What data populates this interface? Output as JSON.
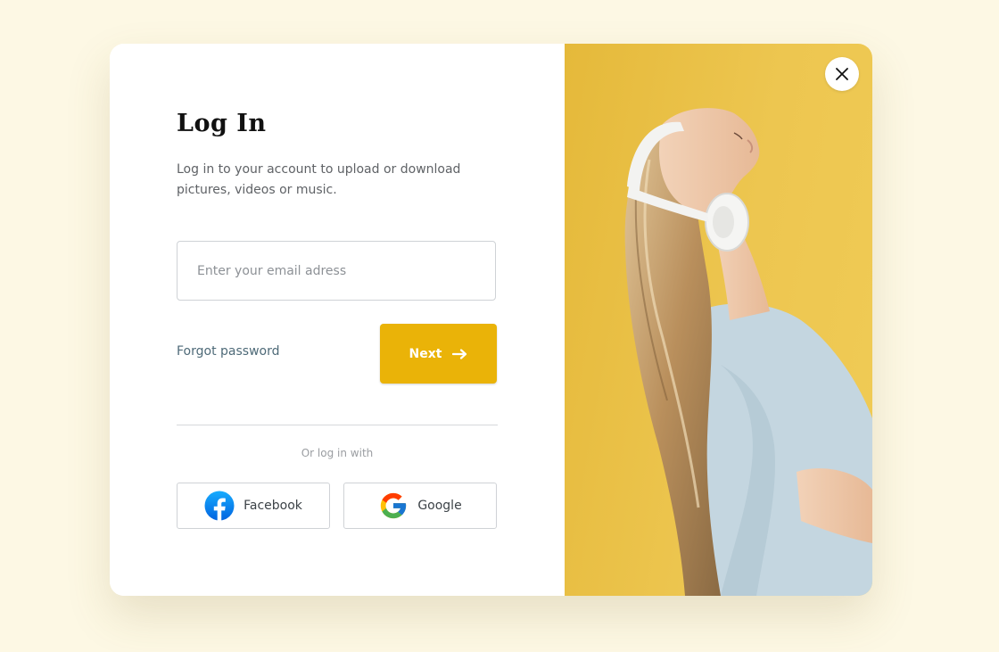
{
  "login": {
    "title": "Log In",
    "subtitle": "Log in to your account to upload or download pictures, videos or music.",
    "email_placeholder": "Enter your email adress",
    "forgot_password": "Forgot password",
    "next_label": "Next",
    "divider_text": "Or log in with",
    "facebook_label": "Facebook",
    "google_label": "Google"
  },
  "icons": {
    "close": "close-icon",
    "next_arrow": "arrow-right-icon",
    "facebook": "facebook-logo-icon",
    "google": "google-logo-icon"
  },
  "colors": {
    "background": "#fdf8e4",
    "accent": "#eab308",
    "image_bg": "#ecc24a",
    "link": "#4e6a78"
  }
}
